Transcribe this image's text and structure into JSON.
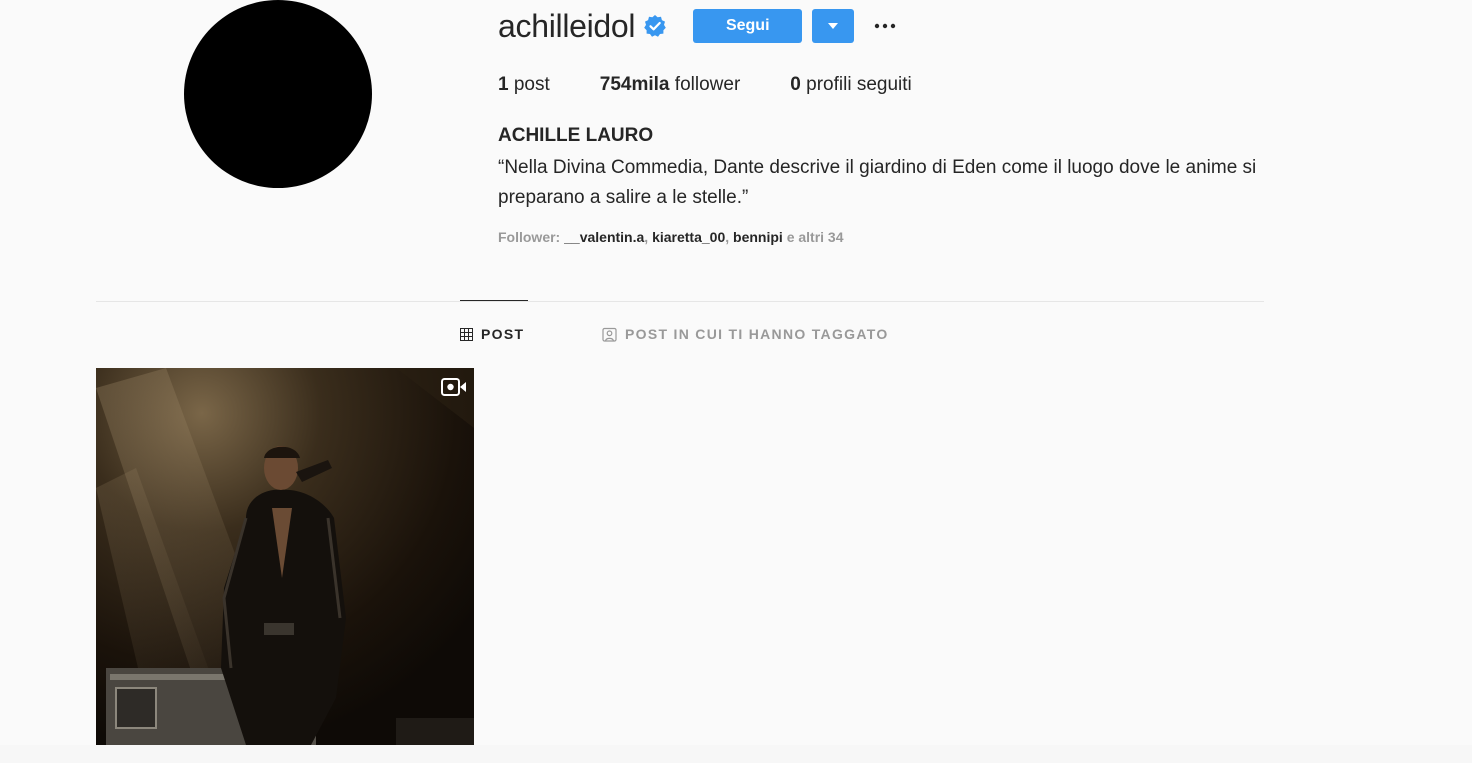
{
  "profile": {
    "username": "achilleidol",
    "verified": true,
    "follow_label": "Segui",
    "more_label": "···",
    "stats": {
      "posts_count": "1",
      "posts_label": "post",
      "followers_count": "754mila",
      "followers_label": "follower",
      "following_count": "0",
      "following_label": "profili seguiti"
    },
    "full_name": "ACHILLE LAURO",
    "bio": "“Nella Divina Commedia, Dante descrive il giardino di Eden come il luogo dove le anime si preparano a salire a le stelle.”",
    "followed_by": {
      "prefix": "Follower:",
      "names": [
        "__valentin.a",
        "kiaretta_00",
        "bennipi"
      ],
      "others": "e altri 34"
    }
  },
  "tabs": [
    {
      "label": "POST",
      "icon": "grid-icon",
      "active": true
    },
    {
      "label": "POST IN CUI TI HANNO TAGGATO",
      "icon": "tagged-user-icon",
      "active": false
    }
  ],
  "posts": [
    {
      "type": "video",
      "icon": "video-icon"
    }
  ],
  "colors": {
    "accent": "#3897f0",
    "text": "#262626",
    "muted": "#999999",
    "background": "#fafafa"
  }
}
